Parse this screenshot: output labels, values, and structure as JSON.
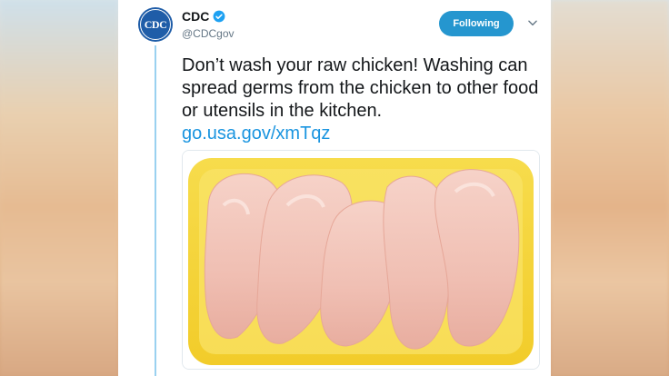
{
  "tweet": {
    "display_name": "CDC",
    "avatar_text": "CDC",
    "handle": "@CDCgov",
    "follow_label": "Following",
    "text": "Don’t wash your raw chicken! Washing can spread germs from the chicken to other food or utensils in the kitchen.",
    "link": "go.usa.gov/xmTqz",
    "media": {
      "alt": "raw chicken breasts in a yellow foam tray"
    }
  },
  "icons": {
    "verified": "verified-badge-icon",
    "menu": "chevron-down-icon"
  },
  "colors": {
    "follow_button": "#2596cf",
    "link": "#1b95e0",
    "thread_line": "#9ad1f0",
    "avatar_bg": "#1f5da8"
  }
}
